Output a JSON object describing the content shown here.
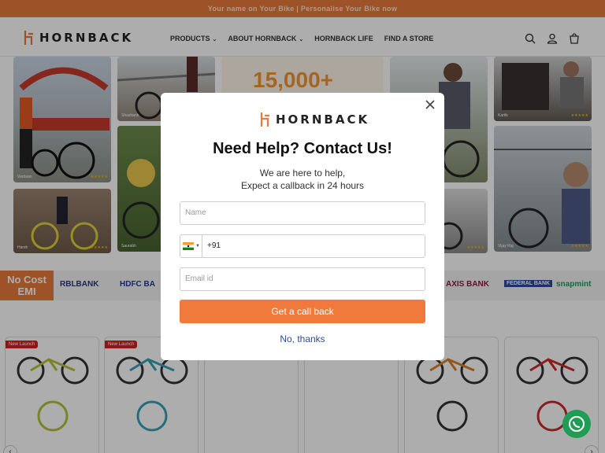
{
  "announcement": "Your name on Your Bike | Personalise Your Bike now",
  "brand": "HORNBACK",
  "nav": [
    {
      "label": "PRODUCTS",
      "dropdown": true
    },
    {
      "label": "ABOUT HORNBACK",
      "dropdown": true
    },
    {
      "label": "HORNBACK LIFE",
      "dropdown": false
    },
    {
      "label": "FIND A STORE",
      "dropdown": false
    }
  ],
  "gallery": {
    "big_number": "15,000+",
    "tile_labels": [
      "Vardaan",
      "Harsh",
      "Shashank",
      "Saurabh",
      "Kartik",
      "Vijay Raj"
    ]
  },
  "bank_strip": {
    "emi_label": "No Cost EMI",
    "banks": [
      "RBLBANK",
      "HDFC BA",
      "AXIS BANK",
      "FEDERAL BANK",
      "snapmint"
    ]
  },
  "badges": [
    "New Launch",
    "New Launch"
  ],
  "modal": {
    "title": "Need Help? Contact Us!",
    "subtitle_line1": "We are here to help,",
    "subtitle_line2": "Expect a callback in 24 hours",
    "name_placeholder": "Name",
    "phone_code": "+91",
    "email_placeholder": "Email id",
    "cta_label": "Get a call back",
    "dismiss_label": "No, thanks"
  },
  "colors": {
    "accent": "#f07a3b",
    "announce_bg": "#e87a3a",
    "link": "#2f4a9a",
    "whatsapp": "#1f9d55"
  }
}
